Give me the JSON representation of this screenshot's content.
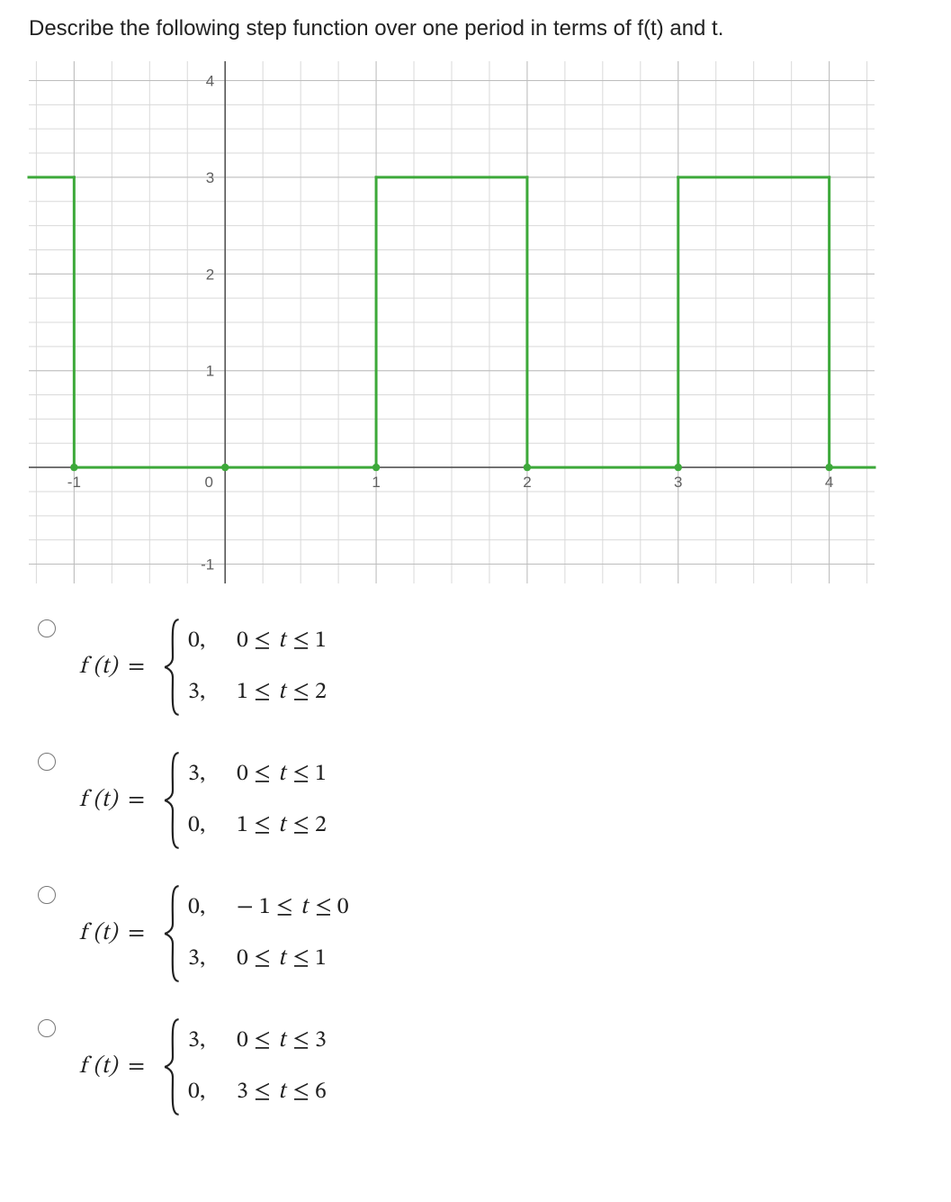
{
  "question": "Describe the following step function over one period in terms of f(t) and t.",
  "chart_data": {
    "type": "line",
    "function": "periodic step",
    "period": 2,
    "xlabel": "",
    "ylabel": "",
    "xlim": [
      -1.3,
      4.3
    ],
    "ylim": [
      -1.2,
      4.2
    ],
    "xticks": [
      -1,
      0,
      1,
      2,
      3,
      4
    ],
    "yticks": [
      -1,
      0,
      1,
      2,
      3,
      4
    ],
    "series": [
      {
        "name": "f(t)",
        "color": "#3da93a",
        "segments": [
          {
            "from": [
              -1.3,
              3
            ],
            "to": [
              -1,
              3
            ]
          },
          {
            "from": [
              -1,
              3
            ],
            "to": [
              -1,
              0
            ]
          },
          {
            "from": [
              -1,
              0
            ],
            "to": [
              0,
              0
            ]
          },
          {
            "from": [
              0,
              0
            ],
            "to": [
              0,
              0
            ]
          },
          {
            "from": [
              0,
              0
            ],
            "to": [
              1,
              0
            ]
          },
          {
            "from": [
              1,
              0
            ],
            "to": [
              1,
              3
            ]
          },
          {
            "from": [
              1,
              3
            ],
            "to": [
              2,
              3
            ]
          },
          {
            "from": [
              2,
              3
            ],
            "to": [
              2,
              0
            ]
          },
          {
            "from": [
              2,
              0
            ],
            "to": [
              3,
              0
            ]
          },
          {
            "from": [
              3,
              0
            ],
            "to": [
              3,
              3
            ]
          },
          {
            "from": [
              3,
              3
            ],
            "to": [
              4,
              3
            ]
          },
          {
            "from": [
              4,
              3
            ],
            "to": [
              4,
              0
            ]
          },
          {
            "from": [
              4,
              0
            ],
            "to": [
              4.3,
              0
            ]
          }
        ]
      }
    ],
    "one_period_definition": {
      "pieces": [
        {
          "value": 0,
          "interval": [
            0,
            1
          ]
        },
        {
          "value": 3,
          "interval": [
            1,
            2
          ]
        }
      ]
    }
  },
  "options": [
    {
      "lhs": "f (t)",
      "cases": [
        {
          "value": "0,",
          "cond_pre": "0 ≤",
          "cond_post": "≤ 1"
        },
        {
          "value": "3,",
          "cond_pre": "1 ≤",
          "cond_post": "≤ 2"
        }
      ]
    },
    {
      "lhs": "f (t)",
      "cases": [
        {
          "value": "3,",
          "cond_pre": "0 ≤",
          "cond_post": "≤ 1"
        },
        {
          "value": "0,",
          "cond_pre": "1 ≤",
          "cond_post": "≤ 2"
        }
      ]
    },
    {
      "lhs": "f (t)",
      "cases": [
        {
          "value": "0,",
          "cond_pre": "− 1 ≤",
          "cond_post": "≤ 0"
        },
        {
          "value": "3,",
          "cond_pre": "0 ≤",
          "cond_post": "≤ 1"
        }
      ]
    },
    {
      "lhs": "f (t)",
      "cases": [
        {
          "value": "3,",
          "cond_pre": "0 ≤",
          "cond_post": "≤ 3"
        },
        {
          "value": "0,",
          "cond_pre": "3 ≤",
          "cond_post": "≤ 6"
        }
      ]
    }
  ]
}
